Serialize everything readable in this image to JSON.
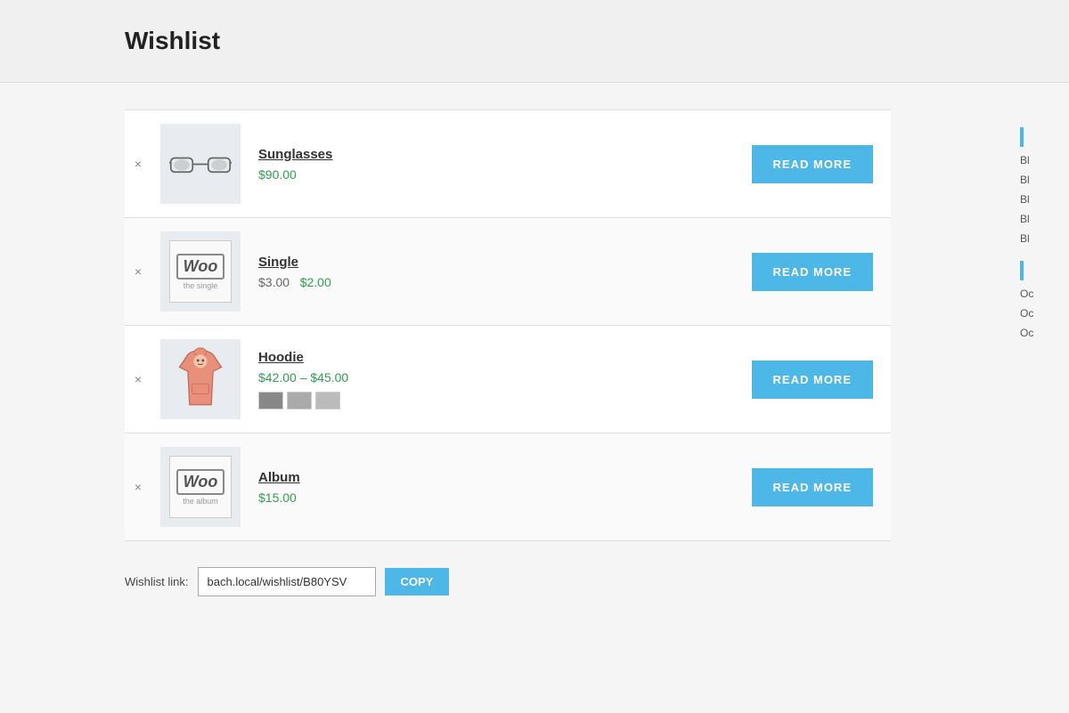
{
  "page": {
    "title": "Wishlist"
  },
  "products": [
    {
      "id": "sunglasses",
      "name": "Sunglasses",
      "price_display": "$90.00",
      "price_type": "single",
      "original_price": null,
      "sale_price": null,
      "price_color": "green",
      "image_type": "sunglasses",
      "has_swatches": false,
      "read_more_label": "READ MORE"
    },
    {
      "id": "single",
      "name": "Single",
      "price_display": null,
      "price_type": "sale",
      "original_price": "$3.00",
      "sale_price": "$2.00",
      "price_color": "mixed",
      "image_type": "woo-single",
      "has_swatches": false,
      "read_more_label": "READ MORE"
    },
    {
      "id": "hoodie",
      "name": "Hoodie",
      "price_display": "$42.00 – $45.00",
      "price_type": "range",
      "original_price": null,
      "sale_price": null,
      "price_color": "green",
      "image_type": "hoodie",
      "has_swatches": true,
      "swatches": [
        "#888",
        "#aaa",
        "#bbb"
      ],
      "read_more_label": "READ MORE"
    },
    {
      "id": "album",
      "name": "Album",
      "price_display": "$15.00",
      "price_type": "single",
      "original_price": null,
      "sale_price": null,
      "price_color": "green",
      "image_type": "woo-album",
      "has_swatches": false,
      "read_more_label": "READ MORE"
    }
  ],
  "wishlist_link": {
    "label": "Wishlist link:",
    "value": "bach.local/wishlist/B80YSV",
    "copy_label": "COPY"
  },
  "sidebar": {
    "items": [
      {
        "label": "Bl"
      },
      {
        "label": "Bl"
      },
      {
        "label": "Bl"
      },
      {
        "label": "Bl"
      },
      {
        "label": "Bl"
      },
      {
        "label": "Oc"
      },
      {
        "label": "Oc"
      },
      {
        "label": "Oc"
      }
    ]
  }
}
